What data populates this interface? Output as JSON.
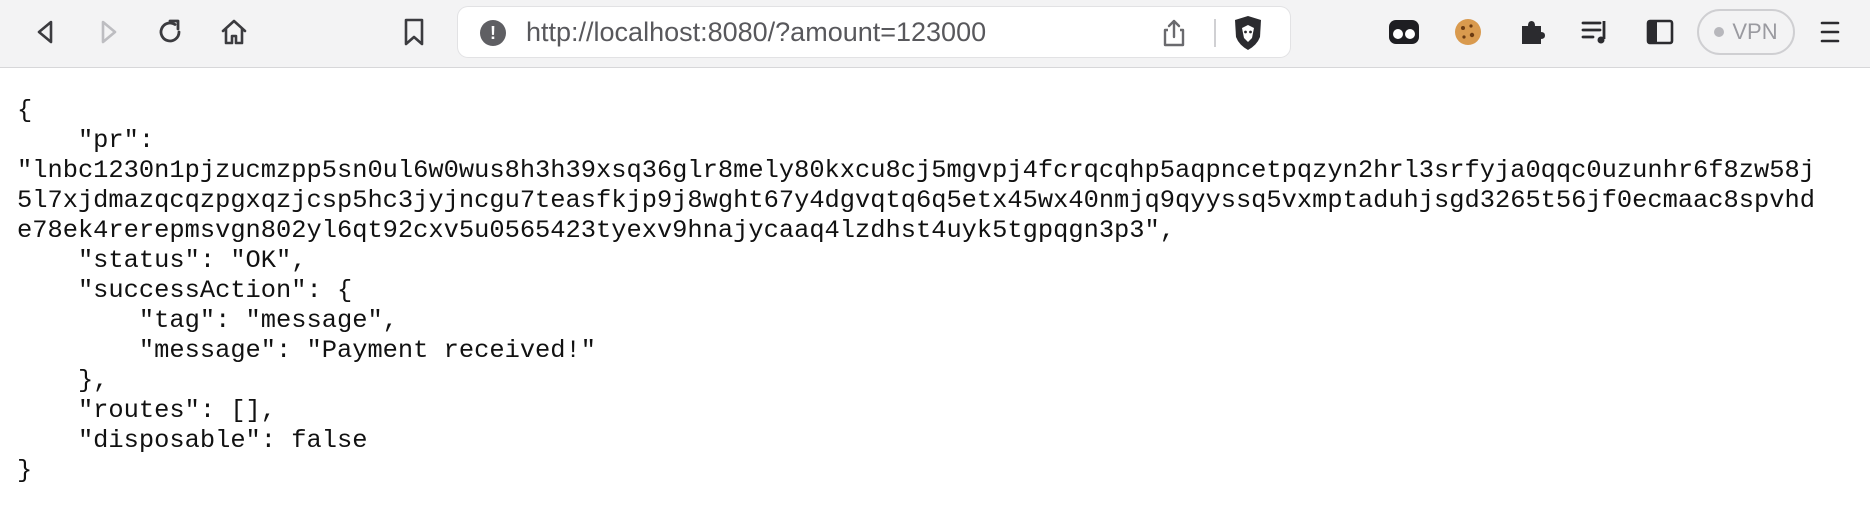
{
  "browser": {
    "address_bar": {
      "url": "http://localhost:8080/?amount=123000",
      "info_icon": "info-icon",
      "share_icon": "share-icon",
      "shield_icon": "brave-shield-icon"
    },
    "nav_icons": [
      "back-icon",
      "forward-icon",
      "reload-icon",
      "home-icon",
      "bookmark-icon"
    ],
    "extension_icons": [
      "extension-glasses-icon",
      "cookie-icon",
      "puzzle-icon",
      "playlist-icon",
      "sidebar-icon"
    ],
    "vpn_label": "VPN",
    "menu_icon": "hamburger-menu-icon",
    "colors": {
      "toolbar_bg": "#f3f3f4",
      "url_text": "#58585c",
      "page_text": "#111111"
    }
  },
  "json_view": {
    "open_brace": "{",
    "pr_key": "    \"pr\":",
    "pr_line1": "\"lnbc1230n1pjzucmzpp5sn0ul6w0wus8h3h39xsq36glr8mely80kxcu8cj5mgvpj4fcrqcqhp5aqpncetpqzyn2hrl3srfyja0qqc0uzunhr6f8zw58j",
    "pr_line2": "5l7xjdmazqcqzpgxqzjcsp5hc3jyjncgu7teasfkjp9j8wght67y4dgvqtq6q5etx45wx40nmjq9qyyssq5vxmptaduhjsgd3265t56jf0ecmaac8spvhd",
    "pr_line3": "e78ek4rerepmsvgn802yl6qt92cxv5u0565423tyexv9hnajycaaq4lzdhst4uyk5tgpqgn3p3\",",
    "status_line": "    \"status\": \"OK\",",
    "success_open": "    \"successAction\": {",
    "tag_line": "        \"tag\": \"message\",",
    "message_line": "        \"message\": \"Payment received!\"",
    "success_close": "    },",
    "routes_line": "    \"routes\": [],",
    "disposable_line": "    \"disposable\": false",
    "close_brace": "}"
  }
}
